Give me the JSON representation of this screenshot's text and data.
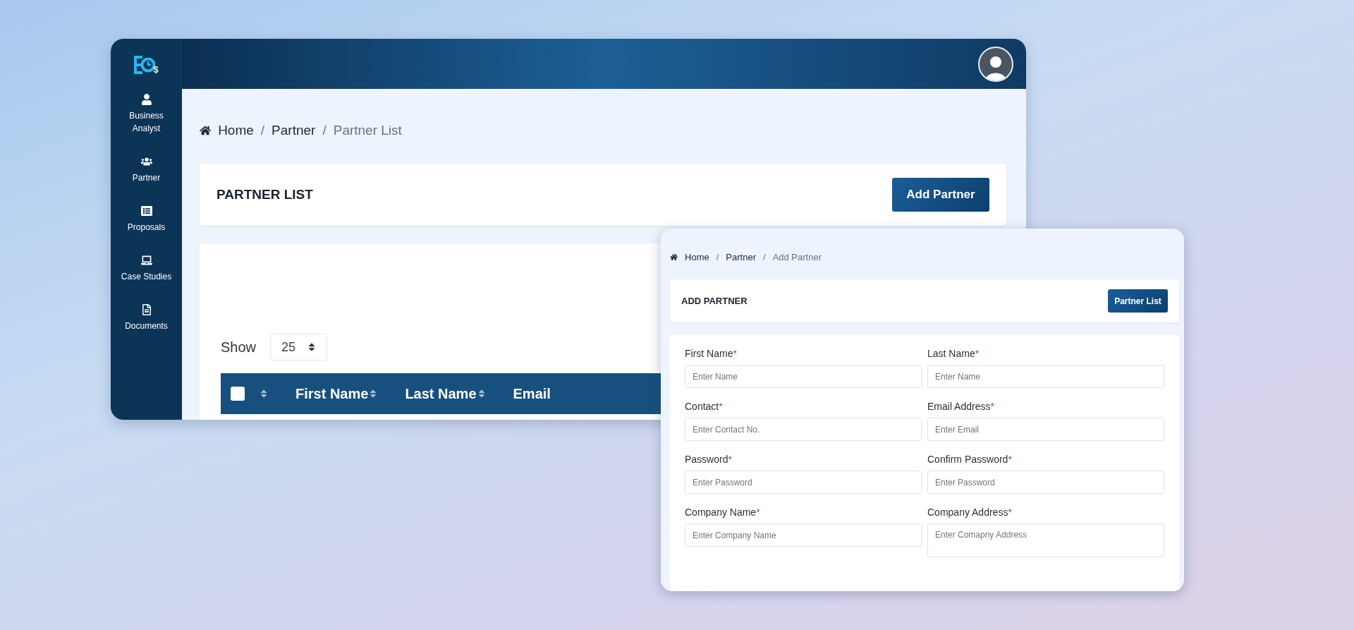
{
  "list_window": {
    "logo": {
      "mark": "$"
    },
    "sidebar": {
      "items": [
        {
          "label": "Business Analyst"
        },
        {
          "label": "Partner"
        },
        {
          "label": "Proposals"
        },
        {
          "label": "Case Studies"
        },
        {
          "label": "Documents"
        }
      ]
    },
    "breadcrumb": [
      {
        "label": "Home",
        "current": false
      },
      {
        "separator": "/",
        "label": "Partner",
        "current": false
      },
      {
        "separator": "/",
        "label": "Partner List",
        "current": true
      }
    ],
    "title": "PARTNER LIST",
    "button": "Add Partner",
    "show_label": "Show",
    "page_size": "25",
    "table": {
      "select_all": {
        "checked": false
      },
      "columns": [
        {
          "sortable": true
        },
        {
          "label": "First Name",
          "sortable": true
        },
        {
          "label": "Last Name",
          "sortable": true
        },
        {
          "label": "Email",
          "sortable": false
        }
      ]
    }
  },
  "form_window": {
    "breadcrumb": [
      {
        "label": "Home",
        "current": false
      },
      {
        "separator": "/",
        "label": "Partner",
        "current": false
      },
      {
        "separator": "/",
        "label": "Add Partner",
        "current": true
      }
    ],
    "title": "ADD PARTNER",
    "button": "Partner List",
    "fields": [
      {
        "label": "First Name",
        "required_mark": "*",
        "placeholder": "Enter Name",
        "kind": "input"
      },
      {
        "label": "Last Name",
        "required_mark": "*",
        "placeholder": "Enter Name",
        "kind": "input"
      },
      {
        "label": "Contact",
        "required_mark": "*",
        "placeholder": "Enter Contact No.",
        "kind": "input"
      },
      {
        "label": "Email Address",
        "required_mark": "*",
        "placeholder": "Enter Email",
        "kind": "input"
      },
      {
        "label": "Password",
        "required_mark": "*",
        "placeholder": "Enter Password",
        "kind": "input"
      },
      {
        "label": "Confirm Password",
        "required_mark": "*",
        "placeholder": "Enter Password",
        "kind": "input"
      },
      {
        "label": "Company Name",
        "required_mark": "*",
        "placeholder": "Enter Company Name",
        "kind": "input"
      },
      {
        "label": "Company Address",
        "required_mark": "*",
        "placeholder": "Enter Comapny Address",
        "kind": "textarea"
      }
    ]
  }
}
